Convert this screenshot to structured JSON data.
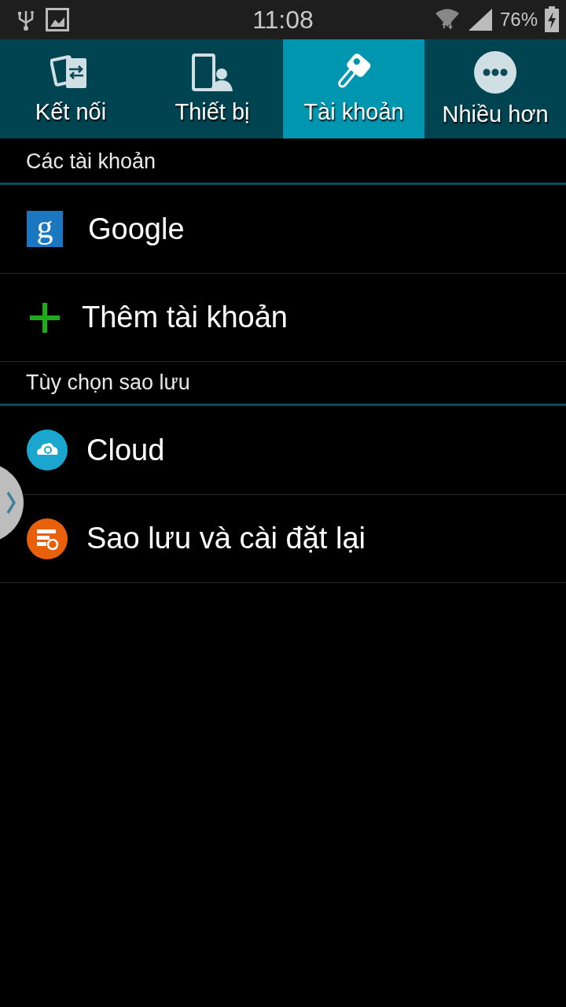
{
  "status_bar": {
    "time": "11:08",
    "battery": "76%"
  },
  "tabs": [
    {
      "kind": "connections",
      "label": "Kết nối",
      "selected": false
    },
    {
      "kind": "device",
      "label": "Thiết bị",
      "selected": false
    },
    {
      "kind": "accounts",
      "label": "Tài khoản",
      "selected": true
    },
    {
      "kind": "more",
      "label": "Nhiều hơn",
      "selected": false
    }
  ],
  "sections": [
    {
      "title": "Các tài khoản",
      "items": [
        {
          "kind": "google",
          "label": "Google",
          "icon_text": "g"
        },
        {
          "kind": "add",
          "label": "Thêm tài khoản"
        }
      ]
    },
    {
      "title": "Tùy chọn sao lưu",
      "items": [
        {
          "kind": "cloud",
          "label": "Cloud"
        },
        {
          "kind": "backup",
          "label": "Sao lưu và cài đặt lại"
        }
      ]
    }
  ]
}
